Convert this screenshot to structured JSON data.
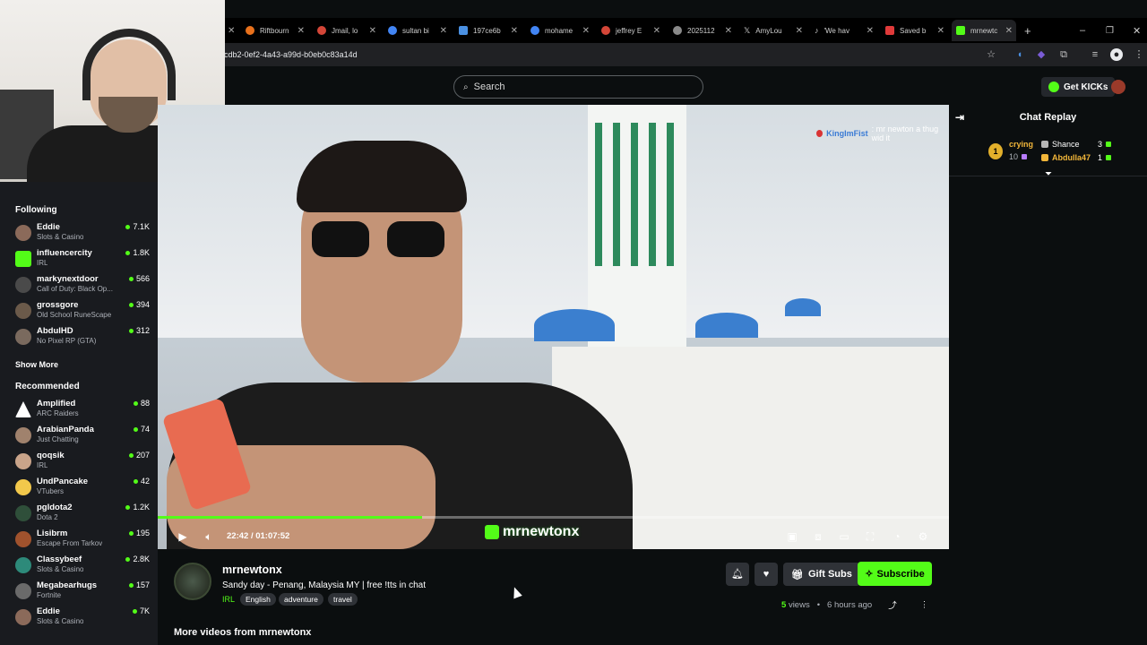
{
  "browser": {
    "tabs": [
      {
        "label": "Riftbourn",
        "color": "#e8711c"
      },
      {
        "label": "Jmail, lo",
        "color": "#d44638"
      },
      {
        "label": "sultan bi",
        "color": "#4285f4"
      },
      {
        "label": "197ce6b",
        "color": "#4a90e2"
      },
      {
        "label": "mohame",
        "color": "#4285f4"
      },
      {
        "label": "jeffrey E",
        "color": "#d44638"
      },
      {
        "label": "2025112",
        "color": "#8a8a8a"
      },
      {
        "label": "AmyLou",
        "color": "#ffffff"
      },
      {
        "label": "'We hav",
        "color": "#111111"
      },
      {
        "label": "Saved b",
        "color": "#e03a3a"
      },
      {
        "label": "mrnewtc",
        "color": "#53fc18"
      }
    ],
    "url": "cdb2-0ef2-4a43-a99d-b0eb0c83a14d"
  },
  "header": {
    "search_placeholder": "Search",
    "get_kicks_label": "Get KICKs"
  },
  "sidebar": {
    "following_label": "Following",
    "following": [
      {
        "name": "Eddie",
        "category": "Slots & Casino",
        "viewers": "7.1K",
        "color": "#8b6a5a"
      },
      {
        "name": "influencercity",
        "category": "IRL",
        "viewers": "1.8K",
        "color": "#53fc18"
      },
      {
        "name": "markynextdoor",
        "category": "Call of Duty: Black Op...",
        "viewers": "566",
        "color": "#4a4a4a"
      },
      {
        "name": "grossgore",
        "category": "Old School RuneScape",
        "viewers": "394",
        "color": "#6b5a4a"
      },
      {
        "name": "AbdulHD",
        "category": "No Pixel RP (GTA)",
        "viewers": "312",
        "color": "#7a6a5e"
      }
    ],
    "show_more_label": "Show More",
    "recommended_label": "Recommended",
    "recommended": [
      {
        "name": "Amplified",
        "category": "ARC Raiders",
        "viewers": "88",
        "color": "#ffffff"
      },
      {
        "name": "ArabianPanda",
        "category": "Just Chatting",
        "viewers": "74",
        "color": "#a0826d"
      },
      {
        "name": "qoqsik",
        "category": "IRL",
        "viewers": "207",
        "color": "#c9a48a"
      },
      {
        "name": "UndPancake",
        "category": "VTubers",
        "viewers": "42",
        "color": "#f2c84b"
      },
      {
        "name": "pgldota2",
        "category": "Dota 2",
        "viewers": "1.2K",
        "color": "#2f4f3a"
      },
      {
        "name": "Lisibrm",
        "category": "Escape From Tarkov",
        "viewers": "195",
        "color": "#a0522d"
      },
      {
        "name": "Classybeef",
        "category": "Slots & Casino",
        "viewers": "2.8K",
        "color": "#2d8a7a"
      },
      {
        "name": "Megabearhugs",
        "category": "Fortnite",
        "viewers": "157",
        "color": "#6a6a6a"
      },
      {
        "name": "Eddie",
        "category": "Slots & Casino",
        "viewers": "7K",
        "color": "#8b6a5a"
      }
    ]
  },
  "player": {
    "chat_overlay_user": "KingImFist",
    "chat_overlay_text": ": mr newton a thug wid it",
    "watermark": "mrnewtonx",
    "time_current": "22:42",
    "time_total": "01:07:52",
    "progress_fraction": 0.334
  },
  "chat_panel": {
    "title": "Chat Replay",
    "leaderboard": {
      "rank": "1",
      "top_user": "crying",
      "top_count": "10",
      "second_user": "Shance",
      "second_count": "3",
      "third_user": "Abdulla47",
      "third_count": "1"
    }
  },
  "stream": {
    "channel_name": "mrnewtonx",
    "title": "Sandy day - Penang, Malaysia MY | free !tts in chat",
    "category": "IRL",
    "tags": [
      "English",
      "adventure",
      "travel"
    ],
    "gift_subs_label": "Gift Subs",
    "subscribe_label": "Subscribe",
    "views_count": "5",
    "views_label": "views",
    "time_ago": "6 hours ago",
    "more_videos_label": "More videos from mrnewtonx"
  }
}
